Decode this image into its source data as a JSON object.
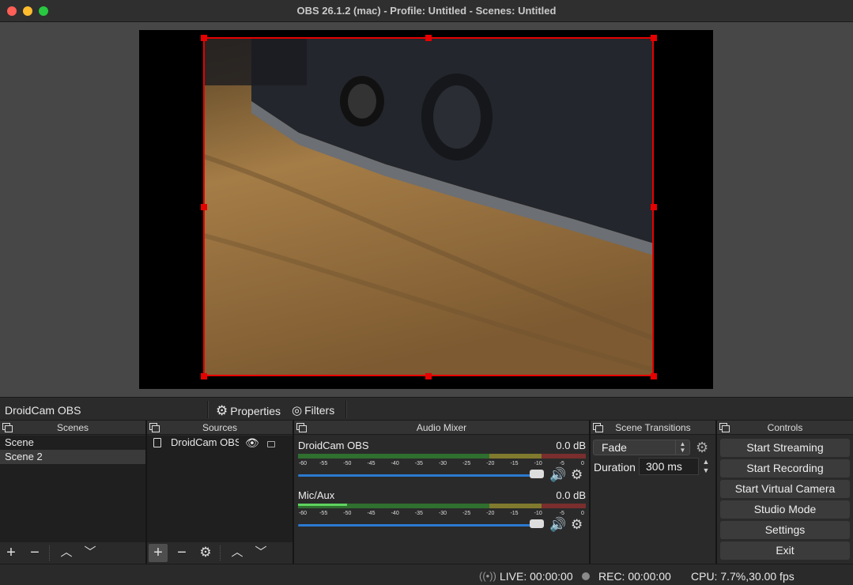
{
  "window": {
    "title": "OBS 26.1.2 (mac) - Profile: Untitled - Scenes: Untitled"
  },
  "context_bar": {
    "source_name": "DroidCam OBS",
    "properties_label": "Properties",
    "filters_label": "Filters"
  },
  "scenes": {
    "header": "Scenes",
    "items": [
      "Scene",
      "Scene 2"
    ],
    "selected": "Scene 2"
  },
  "sources": {
    "header": "Sources",
    "items": [
      {
        "name": "DroidCam OBS",
        "visible": true,
        "locked": false
      }
    ]
  },
  "mixer": {
    "header": "Audio Mixer",
    "scale_labels": [
      "-60",
      "-55",
      "-50",
      "-45",
      "-40",
      "-35",
      "-30",
      "-25",
      "-20",
      "-15",
      "-10",
      "-5",
      "0"
    ],
    "channels": [
      {
        "name": "DroidCam OBS",
        "db": "0.0 dB",
        "volume": 1.0
      },
      {
        "name": "Mic/Aux",
        "db": "0.0 dB",
        "volume": 1.0
      }
    ]
  },
  "transitions": {
    "header": "Scene Transitions",
    "selected": "Fade",
    "duration_label": "Duration",
    "duration_value": "300 ms"
  },
  "controls": {
    "header": "Controls",
    "buttons": [
      "Start Streaming",
      "Start Recording",
      "Start Virtual Camera",
      "Studio Mode",
      "Settings",
      "Exit"
    ]
  },
  "status": {
    "live": "LIVE: 00:00:00",
    "rec": "REC: 00:00:00",
    "cpu": "CPU: 7.7%,30.00 fps"
  },
  "colors": {
    "selection": "#e60000",
    "fader": "#2c7ad1",
    "meter_green": "#2f6f2f",
    "meter_yellow": "#807a2e",
    "meter_red": "#7a2e2e"
  }
}
